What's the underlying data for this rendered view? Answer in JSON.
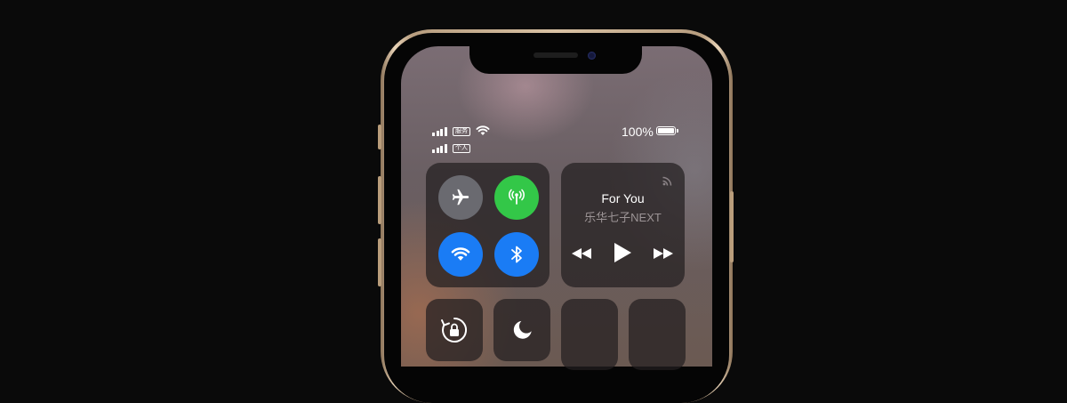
{
  "status_bar": {
    "carrier_1": "服务",
    "carrier_2": "个人",
    "battery_percent": "100%",
    "battery_level": 1.0
  },
  "connectivity": {
    "airplane_mode": {
      "icon": "airplane-icon",
      "state": "off",
      "color": "#6a6a70"
    },
    "cellular_data": {
      "icon": "cellular-antenna-icon",
      "state": "on",
      "color": "#33c748"
    },
    "wifi": {
      "icon": "wifi-icon",
      "state": "on",
      "color": "#1a7cf5"
    },
    "bluetooth": {
      "icon": "bluetooth-icon",
      "state": "on",
      "color": "#1a7cf5"
    }
  },
  "now_playing": {
    "title": "For You",
    "artist": "乐华七子NEXT",
    "airplay_icon": "airplay-icon",
    "controls": [
      "rewind-icon",
      "play-icon",
      "fast-forward-icon"
    ]
  },
  "bottom_tiles": [
    {
      "icon": "orientation-lock-icon"
    },
    {
      "icon": "moon-icon"
    },
    {
      "icon": ""
    },
    {
      "icon": ""
    }
  ]
}
